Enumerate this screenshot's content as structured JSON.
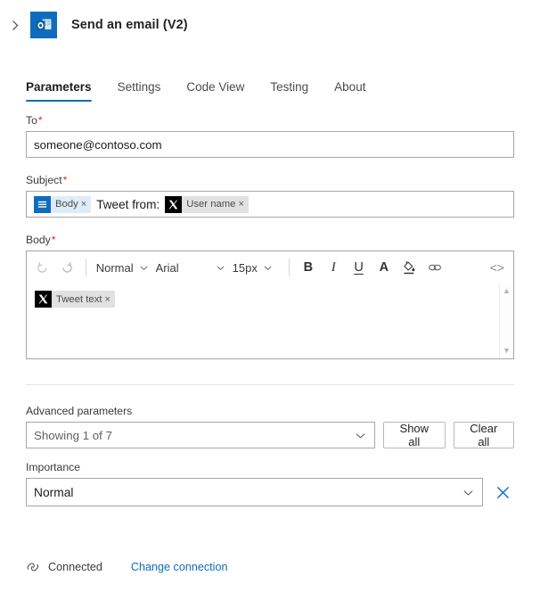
{
  "header": {
    "expand_icon": "chevron-right-icon",
    "app_icon": "outlook-icon",
    "title": "Send an email (V2)"
  },
  "tabs": [
    {
      "label": "Parameters",
      "active": true
    },
    {
      "label": "Settings",
      "active": false
    },
    {
      "label": "Code View",
      "active": false
    },
    {
      "label": "Testing",
      "active": false
    },
    {
      "label": "About",
      "active": false
    }
  ],
  "fields": {
    "to": {
      "label": "To",
      "required": "*",
      "value": "someone@contoso.com"
    },
    "subject": {
      "label": "Subject",
      "required": "*",
      "tokens": [
        {
          "type": "chip",
          "icon": "body-lines-icon",
          "label": "Body",
          "remove": "×",
          "style": "blue"
        },
        {
          "type": "text",
          "label": "Tweet from:"
        },
        {
          "type": "chip",
          "icon": "x-twitter-icon",
          "label": "User name",
          "remove": "×",
          "style": "grey"
        }
      ]
    },
    "body": {
      "label": "Body",
      "required": "*",
      "toolbar": {
        "undo": "undo-icon",
        "redo": "redo-icon",
        "style_value": "Normal",
        "font_value": "Arial",
        "size_value": "15px",
        "bold": "B",
        "italic": "I",
        "underline": "U",
        "font_color": "A",
        "highlight": "paint-bucket-icon",
        "link": "link-icon",
        "code": "<>"
      },
      "tokens": [
        {
          "type": "chip",
          "icon": "x-twitter-icon",
          "label": "Tweet text",
          "remove": "×",
          "style": "grey"
        }
      ],
      "scrollbar": {
        "up": "▲",
        "down": "▼"
      }
    }
  },
  "advanced": {
    "label": "Advanced parameters",
    "select_value": "Showing 1 of 7",
    "show_all_label": "Show all",
    "clear_all_label": "Clear all"
  },
  "importance": {
    "label": "Importance",
    "value": "Normal",
    "delete_icon": "close-icon"
  },
  "footer": {
    "status_icon": "connection-icon",
    "status_text": "Connected",
    "change_link": "Change connection"
  },
  "colors": {
    "accent": "#0f6cbd",
    "required": "#c0392b",
    "chip_blue": "#deecf9",
    "chip_grey": "#e1e1e1",
    "border": "#a6a6a6"
  }
}
